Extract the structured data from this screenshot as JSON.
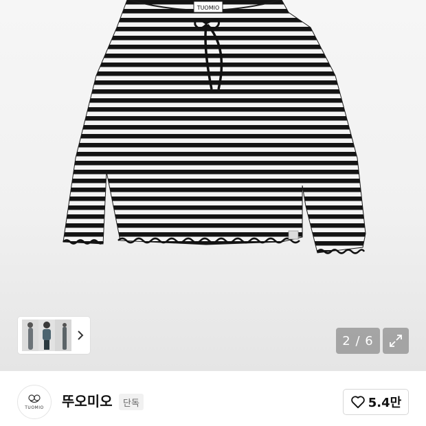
{
  "product_image": {
    "tag_text": "TUOMIO"
  },
  "gallery": {
    "counter": "2 / 6",
    "current": 2,
    "total": 6,
    "thumbnail_next_icon": "chevron-right-icon",
    "expand_icon": "expand-arrows-icon"
  },
  "brand": {
    "logo_text": "TUOMIO",
    "name": "뚜오미오",
    "badge": "단독"
  },
  "like": {
    "icon": "heart-outline-icon",
    "count": "5.4만"
  }
}
